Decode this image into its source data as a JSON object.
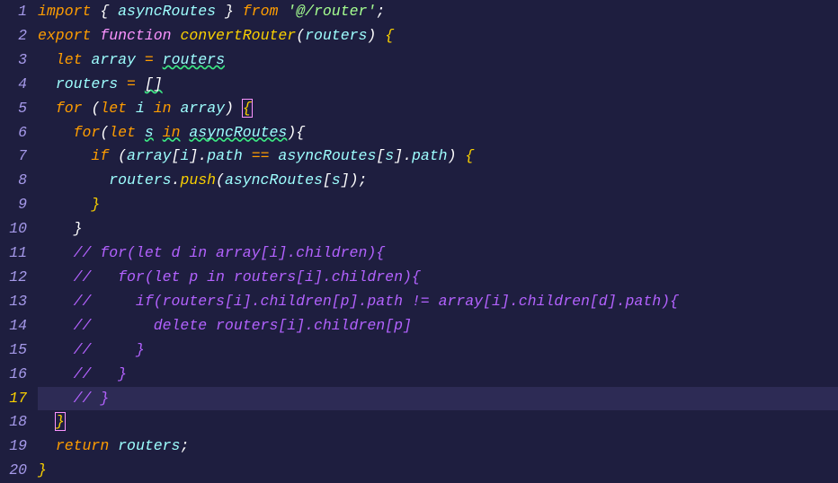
{
  "lines": {
    "l1": {
      "import": "import",
      "lbrace": " { ",
      "name": "asyncRoutes",
      "rbrace": " } ",
      "from": "from",
      "sp": " ",
      "str": "'@/router'",
      "semi": ";"
    },
    "l2": {
      "export": "export",
      "sp1": " ",
      "function": "function",
      "sp2": " ",
      "fn": "convertRouter",
      "lparen": "(",
      "param": "routers",
      "rparen": ")",
      "sp3": " ",
      "lbrace": "{"
    },
    "l3": {
      "indent": "  ",
      "let": "let",
      "sp": " ",
      "name": "array",
      "sp2": " ",
      "eq": "=",
      "sp3": " ",
      "val": "routers"
    },
    "l4": {
      "indent": "  ",
      "name": "routers",
      "sp": " ",
      "eq": "=",
      "sp2": " ",
      "val": "[]"
    },
    "l5": {
      "indent": "  ",
      "for": "for",
      "sp": " ",
      "lparen": "(",
      "let": "let",
      "sp2": " ",
      "i": "i",
      "sp3": " ",
      "in": "in",
      "sp4": " ",
      "arr": "array",
      "rparen": ")",
      "sp5": " ",
      "lbrace": "{"
    },
    "l6": {
      "indent": "    ",
      "for": "for",
      "lparen": "(",
      "let": "let",
      "sp": " ",
      "s": "s",
      "sp2": " ",
      "in": "in",
      "sp3": " ",
      "arr": "asyncRoutes",
      "rparen": ")",
      "lbrace": "{"
    },
    "l7": {
      "indent": "      ",
      "if": "if",
      "sp": " ",
      "lparen": "(",
      "arr": "array",
      "lb1": "[",
      "i": "i",
      "rb1": "]",
      "dot1": ".",
      "path1": "path",
      "sp2": " ",
      "eq": "==",
      "sp3": " ",
      "async": "asyncRoutes",
      "lb2": "[",
      "s": "s",
      "rb2": "]",
      "dot2": ".",
      "path2": "path",
      "rparen": ")",
      "sp4": " ",
      "lbrace": "{"
    },
    "l8": {
      "indent": "        ",
      "routers": "routers",
      "dot": ".",
      "push": "push",
      "lparen": "(",
      "async": "asyncRoutes",
      "lb": "[",
      "s": "s",
      "rb": "]",
      "rparen": ")",
      "semi": ";"
    },
    "l9": {
      "indent": "      ",
      "rbrace": "}"
    },
    "l10": {
      "indent": "    ",
      "rbrace": "}"
    },
    "l11": {
      "indent": "    ",
      "c": "// for(let d in array[i].children){"
    },
    "l12": {
      "indent": "    ",
      "c": "//   for(let p in routers[i].children){"
    },
    "l13": {
      "indent": "    ",
      "c": "//     if(routers[i].children[p].path != array[i].children[d].path){"
    },
    "l14": {
      "indent": "    ",
      "c": "//       delete routers[i].children[p]"
    },
    "l15": {
      "indent": "    ",
      "c": "//     }"
    },
    "l16": {
      "indent": "    ",
      "c": "//   }"
    },
    "l17": {
      "indent": "    ",
      "c": "// }"
    },
    "l18": {
      "indent": "  ",
      "rbrace": "}"
    },
    "l19": {
      "indent": "  ",
      "return": "return",
      "sp": " ",
      "val": "routers",
      "semi": ";"
    },
    "l20": {
      "rbrace": "}"
    }
  },
  "lineNumbers": [
    "1",
    "2",
    "3",
    "4",
    "5",
    "6",
    "7",
    "8",
    "9",
    "10",
    "11",
    "12",
    "13",
    "14",
    "15",
    "16",
    "17",
    "18",
    "19",
    "20"
  ],
  "activeLine": 17
}
